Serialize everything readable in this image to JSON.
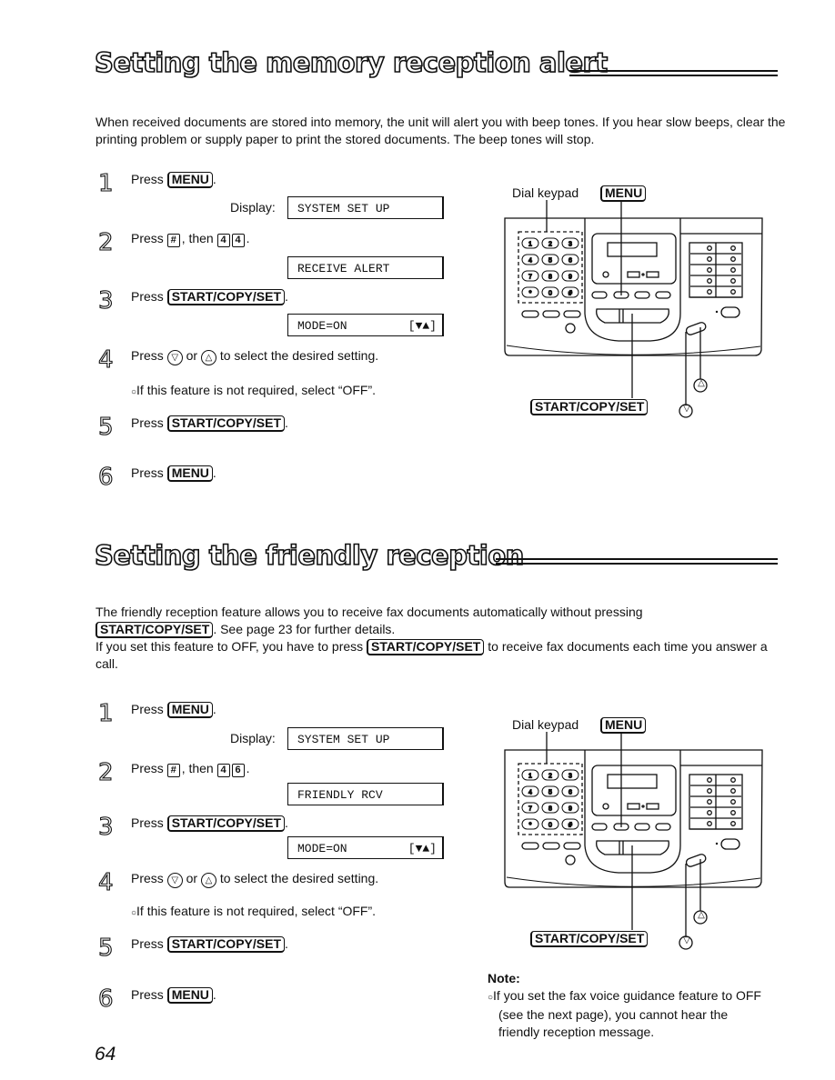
{
  "sections": [
    {
      "title": "Setting the memory reception alert",
      "intro": [
        "When received documents are stored into memory, the unit will alert you with beep tones. If you hear slow beeps, clear the printing problem or supply paper to print the stored documents. The beep tones will stop."
      ],
      "steps": {
        "s1": {
          "num": "1",
          "press": "Press",
          "key": "MENU",
          "display_label": "Display:",
          "display": "SYSTEM SET UP"
        },
        "s2": {
          "num": "2",
          "press": "Press",
          "hash": "#",
          "then": ", then",
          "k1": "4",
          "k2": "4",
          "display": "RECEIVE ALERT"
        },
        "s3": {
          "num": "3",
          "press": "Press",
          "key": "START/COPY/SET",
          "display_mode": "MODE=ON",
          "display_arrows": "[▼▲]"
        },
        "s4": {
          "num": "4",
          "press": "Press",
          "down": "▽",
          "or": "or",
          "up": "△",
          "rest": "to select the desired setting.",
          "bullet": "If this feature is not required, select “OFF”."
        },
        "s5": {
          "num": "5",
          "press": "Press",
          "key": "START/COPY/SET"
        },
        "s6": {
          "num": "6",
          "press": "Press",
          "key": "MENU"
        }
      },
      "diagram": {
        "dial_keypad": "Dial keypad",
        "menu": "MENU",
        "start": "START/COPY/SET",
        "up": "△",
        "down": "▽"
      }
    },
    {
      "title": "Setting the friendly reception",
      "intro_a": "The friendly reception feature allows you to receive fax documents automatically without pressing",
      "intro_key1": "START/COPY/SET",
      "intro_b": ". See page 23 for further details.",
      "intro_c": "If you set this feature to OFF, you have to press",
      "intro_key2": "START/COPY/SET",
      "intro_d": "to receive fax documents each time you answer a call.",
      "steps": {
        "s1": {
          "num": "1",
          "press": "Press",
          "key": "MENU",
          "display_label": "Display:",
          "display": "SYSTEM SET UP"
        },
        "s2": {
          "num": "2",
          "press": "Press",
          "hash": "#",
          "then": ", then",
          "k1": "4",
          "k2": "6",
          "display": "FRIENDLY RCV"
        },
        "s3": {
          "num": "3",
          "press": "Press",
          "key": "START/COPY/SET",
          "display_mode": "MODE=ON",
          "display_arrows": "[▼▲]"
        },
        "s4": {
          "num": "4",
          "press": "Press",
          "down": "▽",
          "or": "or",
          "up": "△",
          "rest": "to select the desired setting.",
          "bullet": "If this feature is not required, select “OFF”."
        },
        "s5": {
          "num": "5",
          "press": "Press",
          "key": "START/COPY/SET"
        },
        "s6": {
          "num": "6",
          "press": "Press",
          "key": "MENU"
        }
      },
      "diagram": {
        "dial_keypad": "Dial keypad",
        "menu": "MENU",
        "start": "START/COPY/SET",
        "up": "△",
        "down": "▽"
      },
      "note": {
        "heading": "Note:",
        "text": "If you set the fax voice guidance feature to OFF (see the next page), you cannot hear the friendly reception message."
      }
    }
  ],
  "page_number": "64"
}
